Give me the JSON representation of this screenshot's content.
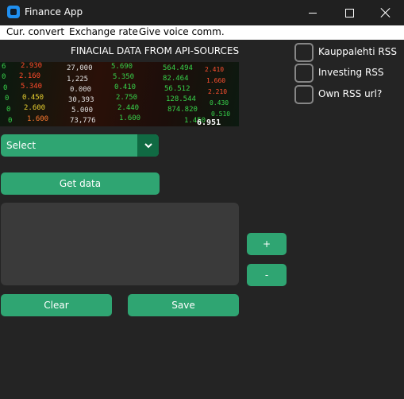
{
  "window": {
    "title": "Finance App"
  },
  "menu": {
    "items": [
      "Cur. convert",
      "Exchange rate",
      "Give voice comm."
    ]
  },
  "header": {
    "text": "FINACIAL DATA FROM API-SOURCES"
  },
  "ticker_image": {
    "numbers_left": [
      "2.930",
      "2.160",
      "5.340",
      "0.450",
      "2.600",
      "1.600"
    ],
    "numbers_mid": [
      "27,000",
      "1,225",
      "0.000",
      "30,393",
      "5.000",
      "73,776"
    ],
    "numbers_right": [
      "5.690",
      "5.350",
      "0.410",
      "2.750",
      "2.440",
      "1.600"
    ],
    "bottom_value": "6.951"
  },
  "dropdown": {
    "selected": "Select"
  },
  "buttons": {
    "get_data": "Get data",
    "plus": "+",
    "minus": "-",
    "clear": "Clear",
    "save": "Save"
  },
  "checkboxes": [
    {
      "label": "Kauppalehti RSS",
      "checked": false
    },
    {
      "label": "Investing RSS",
      "checked": false
    },
    {
      "label": "Own RSS url?",
      "checked": false
    }
  ],
  "colors": {
    "accent": "#2fa572",
    "accent_dark": "#106a43",
    "background": "#242424",
    "textbox": "#3a3a3a"
  }
}
